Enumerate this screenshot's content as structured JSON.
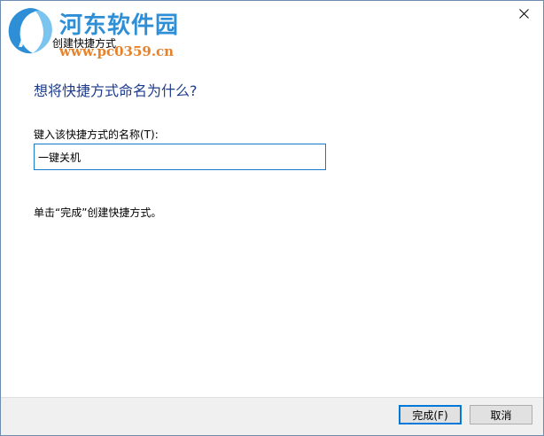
{
  "watermark": {
    "site_name": "河东软件园",
    "url": "www.pc0359.cn"
  },
  "window": {
    "title": "创建快捷方式",
    "close_glyph": "✕"
  },
  "main": {
    "heading": "想将快捷方式命名为什么?",
    "field_label": "键入该快捷方式的名称(T):",
    "name_value": "一键关机",
    "hint": "单击“完成”创建快捷方式。"
  },
  "footer": {
    "finish_label": "完成(F)",
    "cancel_label": "取消"
  },
  "colors": {
    "heading": "#1e3c8c",
    "input_border": "#1a78c8",
    "primary_button_border": "#0078d7",
    "watermark_title": "#2e8fd6",
    "watermark_url": "#e8822a"
  }
}
